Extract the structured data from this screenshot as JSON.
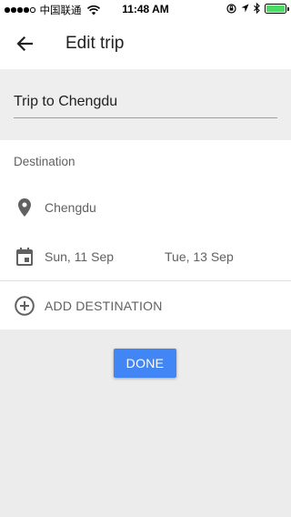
{
  "status_bar": {
    "carrier": "中国联通",
    "time": "11:48 AM",
    "signal_dots_filled": 4,
    "battery_level": 1.0,
    "battery_color": "#4cd964"
  },
  "app_bar": {
    "back_icon": "arrow-back-icon",
    "title": "Edit trip"
  },
  "trip": {
    "name_value": "Trip to Chengdu"
  },
  "destination_section": {
    "label": "Destination",
    "destination": {
      "icon": "location-pin-icon",
      "name": "Chengdu"
    },
    "dates": {
      "icon": "calendar-icon",
      "start": "Sun, 11 Sep",
      "end": "Tue, 13 Sep"
    },
    "add_destination": {
      "icon": "add-circle-icon",
      "label": "ADD DESTINATION"
    }
  },
  "done_button": {
    "label": "DONE",
    "color": "#4285f4"
  },
  "colors": {
    "background": "#ececec",
    "card": "#ffffff",
    "icon": "#616161"
  }
}
